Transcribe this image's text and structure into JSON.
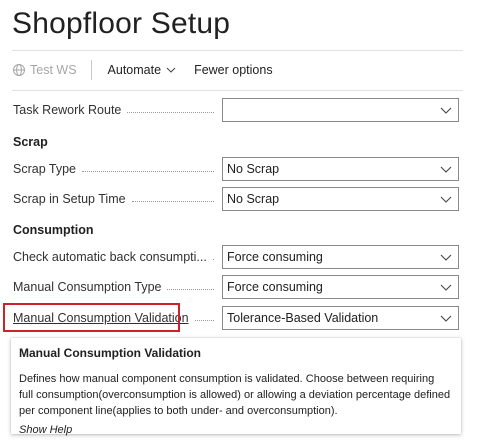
{
  "page": {
    "title": "Shopfloor Setup"
  },
  "toolbar": {
    "test_ws": "Test WS",
    "automate": "Automate",
    "fewer_options": "Fewer options"
  },
  "fields": {
    "task_rework_route": {
      "label": "Task Rework Route",
      "value": ""
    },
    "scrap_type": {
      "label": "Scrap Type",
      "value": "No Scrap"
    },
    "scrap_in_setup_time": {
      "label": "Scrap in Setup Time",
      "value": "No Scrap"
    },
    "check_auto_back": {
      "label": "Check automatic back consumpti...",
      "value": "Force consuming"
    },
    "manual_consumption_type": {
      "label": "Manual Consumption Type",
      "value": "Force consuming"
    },
    "manual_consumption_validation": {
      "label": "Manual Consumption Validation",
      "value": "Tolerance-Based Validation"
    }
  },
  "sections": {
    "scrap": "Scrap",
    "consumption": "Consumption"
  },
  "tooltip": {
    "title": "Manual Consumption Validation",
    "body": "Defines how manual component consumption is validated. Choose between requiring full consumption(overconsumption is allowed) or allowing a deviation percentage defined per component line(applies to both under- and overconsumption).",
    "show_help": "Show Help"
  },
  "colors": {
    "highlight": "#d0202a"
  },
  "icons": {
    "test_ws": "globe-icon",
    "dropdown": "chevron-down-icon"
  }
}
